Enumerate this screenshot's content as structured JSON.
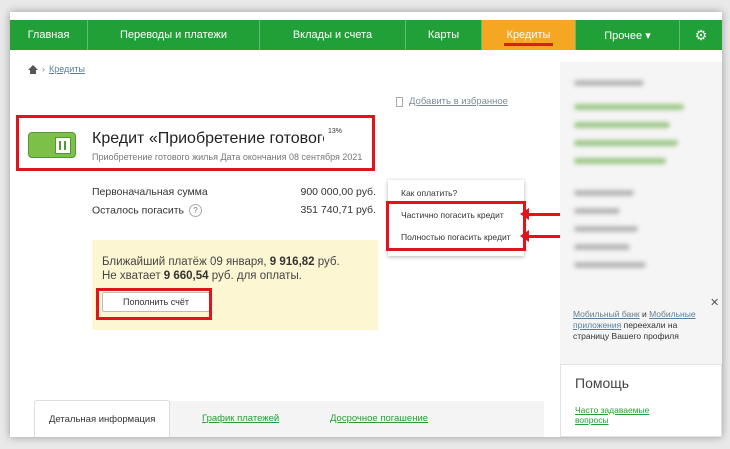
{
  "nav": {
    "items": [
      {
        "label": "Главная"
      },
      {
        "label": "Переводы и платежи"
      },
      {
        "label": "Вклады и счета"
      },
      {
        "label": "Карты"
      },
      {
        "label": "Кредиты",
        "active": true
      },
      {
        "label": "Прочее ▾"
      }
    ],
    "settings_icon": "gear-icon"
  },
  "breadcrumb": {
    "home_icon": "home-icon",
    "current": "Кредиты"
  },
  "favorites": {
    "label": "Добавить в избранное",
    "icon": "bookmark-icon"
  },
  "credit": {
    "icon": "wallet-icon",
    "title": "Кредит «Приобретение готового",
    "rate": "13%",
    "subtitle": "Приобретение готового жилья  Дата окончания 08 сентября 2021",
    "initial_label": "Первоначальная сумма",
    "initial_value": "900 000,00 руб.",
    "remaining_label": "Осталось погасить",
    "remaining_value": "351 740,71 руб.",
    "help_symbol": "?"
  },
  "actions_menu": {
    "how_to_pay": "Как оплатить?",
    "partial": "Частично погасить кредит",
    "full": "Полностью погасить кредит"
  },
  "payment": {
    "line1_prefix": "Ближайший платёж 09 января, ",
    "line1_amount": "9 916,82",
    "line1_suffix": " руб.",
    "line2_prefix": "Не хватает ",
    "line2_amount": "9 660,54",
    "line2_suffix": " руб. для оплаты.",
    "topup_button": "Пополнить счёт"
  },
  "tabs": [
    {
      "label": "Детальная информация",
      "active": true
    },
    {
      "label": "График платежей"
    },
    {
      "label": "Досрочное погашение"
    }
  ],
  "sidebar": {
    "close_symbol": "✕",
    "note_link1": "Мобильный банк",
    "note_and": " и ",
    "note_link2": "Мобильные приложения",
    "note_text": " переехали на страницу Вашего профиля"
  },
  "help": {
    "title": "Помощь",
    "faq_link": "Часто задаваемые вопросы"
  },
  "colors": {
    "brand_green": "#21a038",
    "active_tab": "#f5a623",
    "highlight_red": "#e0151c"
  }
}
